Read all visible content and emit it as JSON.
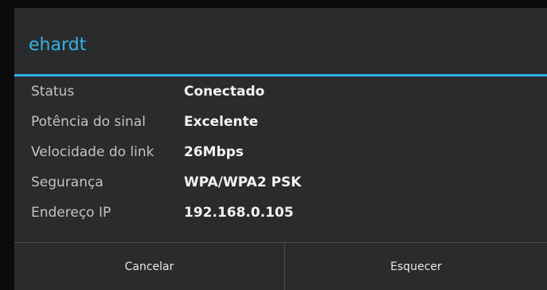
{
  "dialog": {
    "title": "ehardt",
    "rows": [
      {
        "label": "Status",
        "value": "Conectado"
      },
      {
        "label": "Potência do sinal",
        "value": "Excelente"
      },
      {
        "label": "Velocidade do link",
        "value": "26Mbps"
      },
      {
        "label": "Segurança",
        "value": "WPA/WPA2 PSK"
      },
      {
        "label": "Endereço IP",
        "value": "192.168.0.105"
      }
    ],
    "buttons": {
      "cancel": "Cancelar",
      "forget": "Esquecer"
    }
  },
  "colors": {
    "accent": "#33b5e5",
    "dialog_background": "#2a2b2d",
    "label_text": "#c3c3c3",
    "value_text": "#f2f2f2"
  }
}
